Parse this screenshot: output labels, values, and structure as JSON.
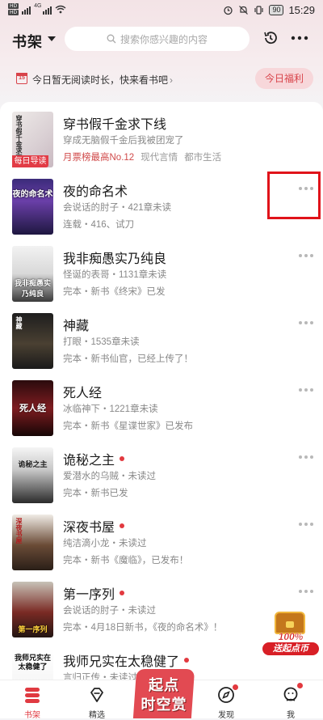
{
  "status_bar": {
    "sim1": "HD",
    "sim2": "HD",
    "network": "4G",
    "battery": "90",
    "time": "15:29"
  },
  "header": {
    "title": "书架",
    "search_placeholder": "搜索你感兴趣的内容"
  },
  "banner": {
    "calendar_day": "15",
    "text": "今日暂无阅读时长，快来看书吧",
    "arrow": "›",
    "button": "今日福利"
  },
  "books": [
    {
      "title": "穿书假千金求下线",
      "line1": "穿成无脑假千金后我被团宠了",
      "line2_rank": "月票榜最高No.12",
      "line2_tags": [
        "现代言情",
        "都市生活"
      ],
      "badge": "每日导读",
      "cover_text": "穿书假千金求下线",
      "new": false
    },
    {
      "title": "夜的命名术",
      "line1": "会说话的肘子・421章未读",
      "line2": "连载・416、试刀",
      "cover_text": "夜的命名术",
      "new": false
    },
    {
      "title": "我非痴愚实乃纯良",
      "line1": "怪诞的表哥・1131章未读",
      "line2": "完本・新书《终宋》已发",
      "cover_text": "我非痴愚实乃纯良",
      "new": false
    },
    {
      "title": "神藏",
      "line1": "打眼・1535章未读",
      "line2": "完本・新书仙官，已经上传了！",
      "cover_text": "神藏",
      "new": false
    },
    {
      "title": "死人经",
      "line1": "冰临神下・1221章未读",
      "line2": "完本・新书《星谍世家》已发布",
      "cover_text": "死人经",
      "new": false
    },
    {
      "title": "诡秘之主",
      "line1": "爱潜水的乌贼・未读过",
      "line2": "完本・新书已发",
      "cover_text": "诡秘之主",
      "new": true
    },
    {
      "title": "深夜书屋",
      "line1": "纯洁滴小龙・未读过",
      "line2": "完本・新书《魔临》，已发布！",
      "cover_text": "深夜书屋",
      "new": true
    },
    {
      "title": "第一序列",
      "line1": "会说话的肘子・未读过",
      "line2": "完本・4月18日新书，《夜的命名术》！",
      "cover_text": "第一序列",
      "new": true
    },
    {
      "title": "我师兄实在太稳健了",
      "line1": "言归正传・未读过",
      "line2": "",
      "cover_text": "我师兄实在太稳健了",
      "new": true
    }
  ],
  "promo": {
    "percent": "100%",
    "text": "送起点币"
  },
  "tabbar": {
    "tabs": [
      {
        "label": "书架",
        "icon": "bookshelf-icon",
        "active": true
      },
      {
        "label": "精选",
        "icon": "diamond-icon",
        "active": false
      },
      {
        "label": "发现",
        "icon": "compass-icon",
        "active": false
      },
      {
        "label": "我",
        "icon": "user-icon",
        "active": false
      }
    ],
    "center_line1": "起点",
    "center_line2": "时空赏"
  },
  "colors": {
    "accent": "#e03a41",
    "highlight_box": "#e0131a"
  }
}
